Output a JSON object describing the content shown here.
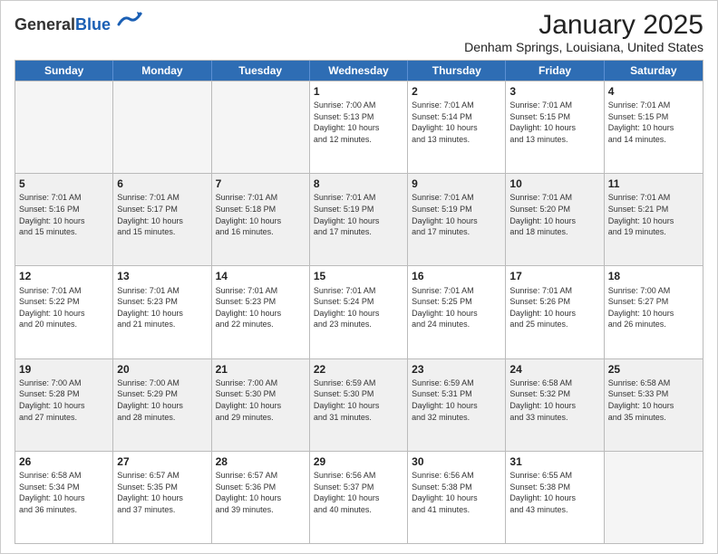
{
  "logo": {
    "general": "General",
    "blue": "Blue"
  },
  "title": "January 2025",
  "location": "Denham Springs, Louisiana, United States",
  "days_of_week": [
    "Sunday",
    "Monday",
    "Tuesday",
    "Wednesday",
    "Thursday",
    "Friday",
    "Saturday"
  ],
  "weeks": [
    [
      {
        "day": "",
        "info": "",
        "empty": true
      },
      {
        "day": "",
        "info": "",
        "empty": true
      },
      {
        "day": "",
        "info": "",
        "empty": true
      },
      {
        "day": "1",
        "info": "Sunrise: 7:00 AM\nSunset: 5:13 PM\nDaylight: 10 hours\nand 12 minutes.",
        "empty": false
      },
      {
        "day": "2",
        "info": "Sunrise: 7:01 AM\nSunset: 5:14 PM\nDaylight: 10 hours\nand 13 minutes.",
        "empty": false
      },
      {
        "day": "3",
        "info": "Sunrise: 7:01 AM\nSunset: 5:15 PM\nDaylight: 10 hours\nand 13 minutes.",
        "empty": false
      },
      {
        "day": "4",
        "info": "Sunrise: 7:01 AM\nSunset: 5:15 PM\nDaylight: 10 hours\nand 14 minutes.",
        "empty": false
      }
    ],
    [
      {
        "day": "5",
        "info": "Sunrise: 7:01 AM\nSunset: 5:16 PM\nDaylight: 10 hours\nand 15 minutes.",
        "empty": false
      },
      {
        "day": "6",
        "info": "Sunrise: 7:01 AM\nSunset: 5:17 PM\nDaylight: 10 hours\nand 15 minutes.",
        "empty": false
      },
      {
        "day": "7",
        "info": "Sunrise: 7:01 AM\nSunset: 5:18 PM\nDaylight: 10 hours\nand 16 minutes.",
        "empty": false
      },
      {
        "day": "8",
        "info": "Sunrise: 7:01 AM\nSunset: 5:19 PM\nDaylight: 10 hours\nand 17 minutes.",
        "empty": false
      },
      {
        "day": "9",
        "info": "Sunrise: 7:01 AM\nSunset: 5:19 PM\nDaylight: 10 hours\nand 17 minutes.",
        "empty": false
      },
      {
        "day": "10",
        "info": "Sunrise: 7:01 AM\nSunset: 5:20 PM\nDaylight: 10 hours\nand 18 minutes.",
        "empty": false
      },
      {
        "day": "11",
        "info": "Sunrise: 7:01 AM\nSunset: 5:21 PM\nDaylight: 10 hours\nand 19 minutes.",
        "empty": false
      }
    ],
    [
      {
        "day": "12",
        "info": "Sunrise: 7:01 AM\nSunset: 5:22 PM\nDaylight: 10 hours\nand 20 minutes.",
        "empty": false
      },
      {
        "day": "13",
        "info": "Sunrise: 7:01 AM\nSunset: 5:23 PM\nDaylight: 10 hours\nand 21 minutes.",
        "empty": false
      },
      {
        "day": "14",
        "info": "Sunrise: 7:01 AM\nSunset: 5:23 PM\nDaylight: 10 hours\nand 22 minutes.",
        "empty": false
      },
      {
        "day": "15",
        "info": "Sunrise: 7:01 AM\nSunset: 5:24 PM\nDaylight: 10 hours\nand 23 minutes.",
        "empty": false
      },
      {
        "day": "16",
        "info": "Sunrise: 7:01 AM\nSunset: 5:25 PM\nDaylight: 10 hours\nand 24 minutes.",
        "empty": false
      },
      {
        "day": "17",
        "info": "Sunrise: 7:01 AM\nSunset: 5:26 PM\nDaylight: 10 hours\nand 25 minutes.",
        "empty": false
      },
      {
        "day": "18",
        "info": "Sunrise: 7:00 AM\nSunset: 5:27 PM\nDaylight: 10 hours\nand 26 minutes.",
        "empty": false
      }
    ],
    [
      {
        "day": "19",
        "info": "Sunrise: 7:00 AM\nSunset: 5:28 PM\nDaylight: 10 hours\nand 27 minutes.",
        "empty": false
      },
      {
        "day": "20",
        "info": "Sunrise: 7:00 AM\nSunset: 5:29 PM\nDaylight: 10 hours\nand 28 minutes.",
        "empty": false
      },
      {
        "day": "21",
        "info": "Sunrise: 7:00 AM\nSunset: 5:30 PM\nDaylight: 10 hours\nand 29 minutes.",
        "empty": false
      },
      {
        "day": "22",
        "info": "Sunrise: 6:59 AM\nSunset: 5:30 PM\nDaylight: 10 hours\nand 31 minutes.",
        "empty": false
      },
      {
        "day": "23",
        "info": "Sunrise: 6:59 AM\nSunset: 5:31 PM\nDaylight: 10 hours\nand 32 minutes.",
        "empty": false
      },
      {
        "day": "24",
        "info": "Sunrise: 6:58 AM\nSunset: 5:32 PM\nDaylight: 10 hours\nand 33 minutes.",
        "empty": false
      },
      {
        "day": "25",
        "info": "Sunrise: 6:58 AM\nSunset: 5:33 PM\nDaylight: 10 hours\nand 35 minutes.",
        "empty": false
      }
    ],
    [
      {
        "day": "26",
        "info": "Sunrise: 6:58 AM\nSunset: 5:34 PM\nDaylight: 10 hours\nand 36 minutes.",
        "empty": false
      },
      {
        "day": "27",
        "info": "Sunrise: 6:57 AM\nSunset: 5:35 PM\nDaylight: 10 hours\nand 37 minutes.",
        "empty": false
      },
      {
        "day": "28",
        "info": "Sunrise: 6:57 AM\nSunset: 5:36 PM\nDaylight: 10 hours\nand 39 minutes.",
        "empty": false
      },
      {
        "day": "29",
        "info": "Sunrise: 6:56 AM\nSunset: 5:37 PM\nDaylight: 10 hours\nand 40 minutes.",
        "empty": false
      },
      {
        "day": "30",
        "info": "Sunrise: 6:56 AM\nSunset: 5:38 PM\nDaylight: 10 hours\nand 41 minutes.",
        "empty": false
      },
      {
        "day": "31",
        "info": "Sunrise: 6:55 AM\nSunset: 5:38 PM\nDaylight: 10 hours\nand 43 minutes.",
        "empty": false
      },
      {
        "day": "",
        "info": "",
        "empty": true
      }
    ]
  ]
}
